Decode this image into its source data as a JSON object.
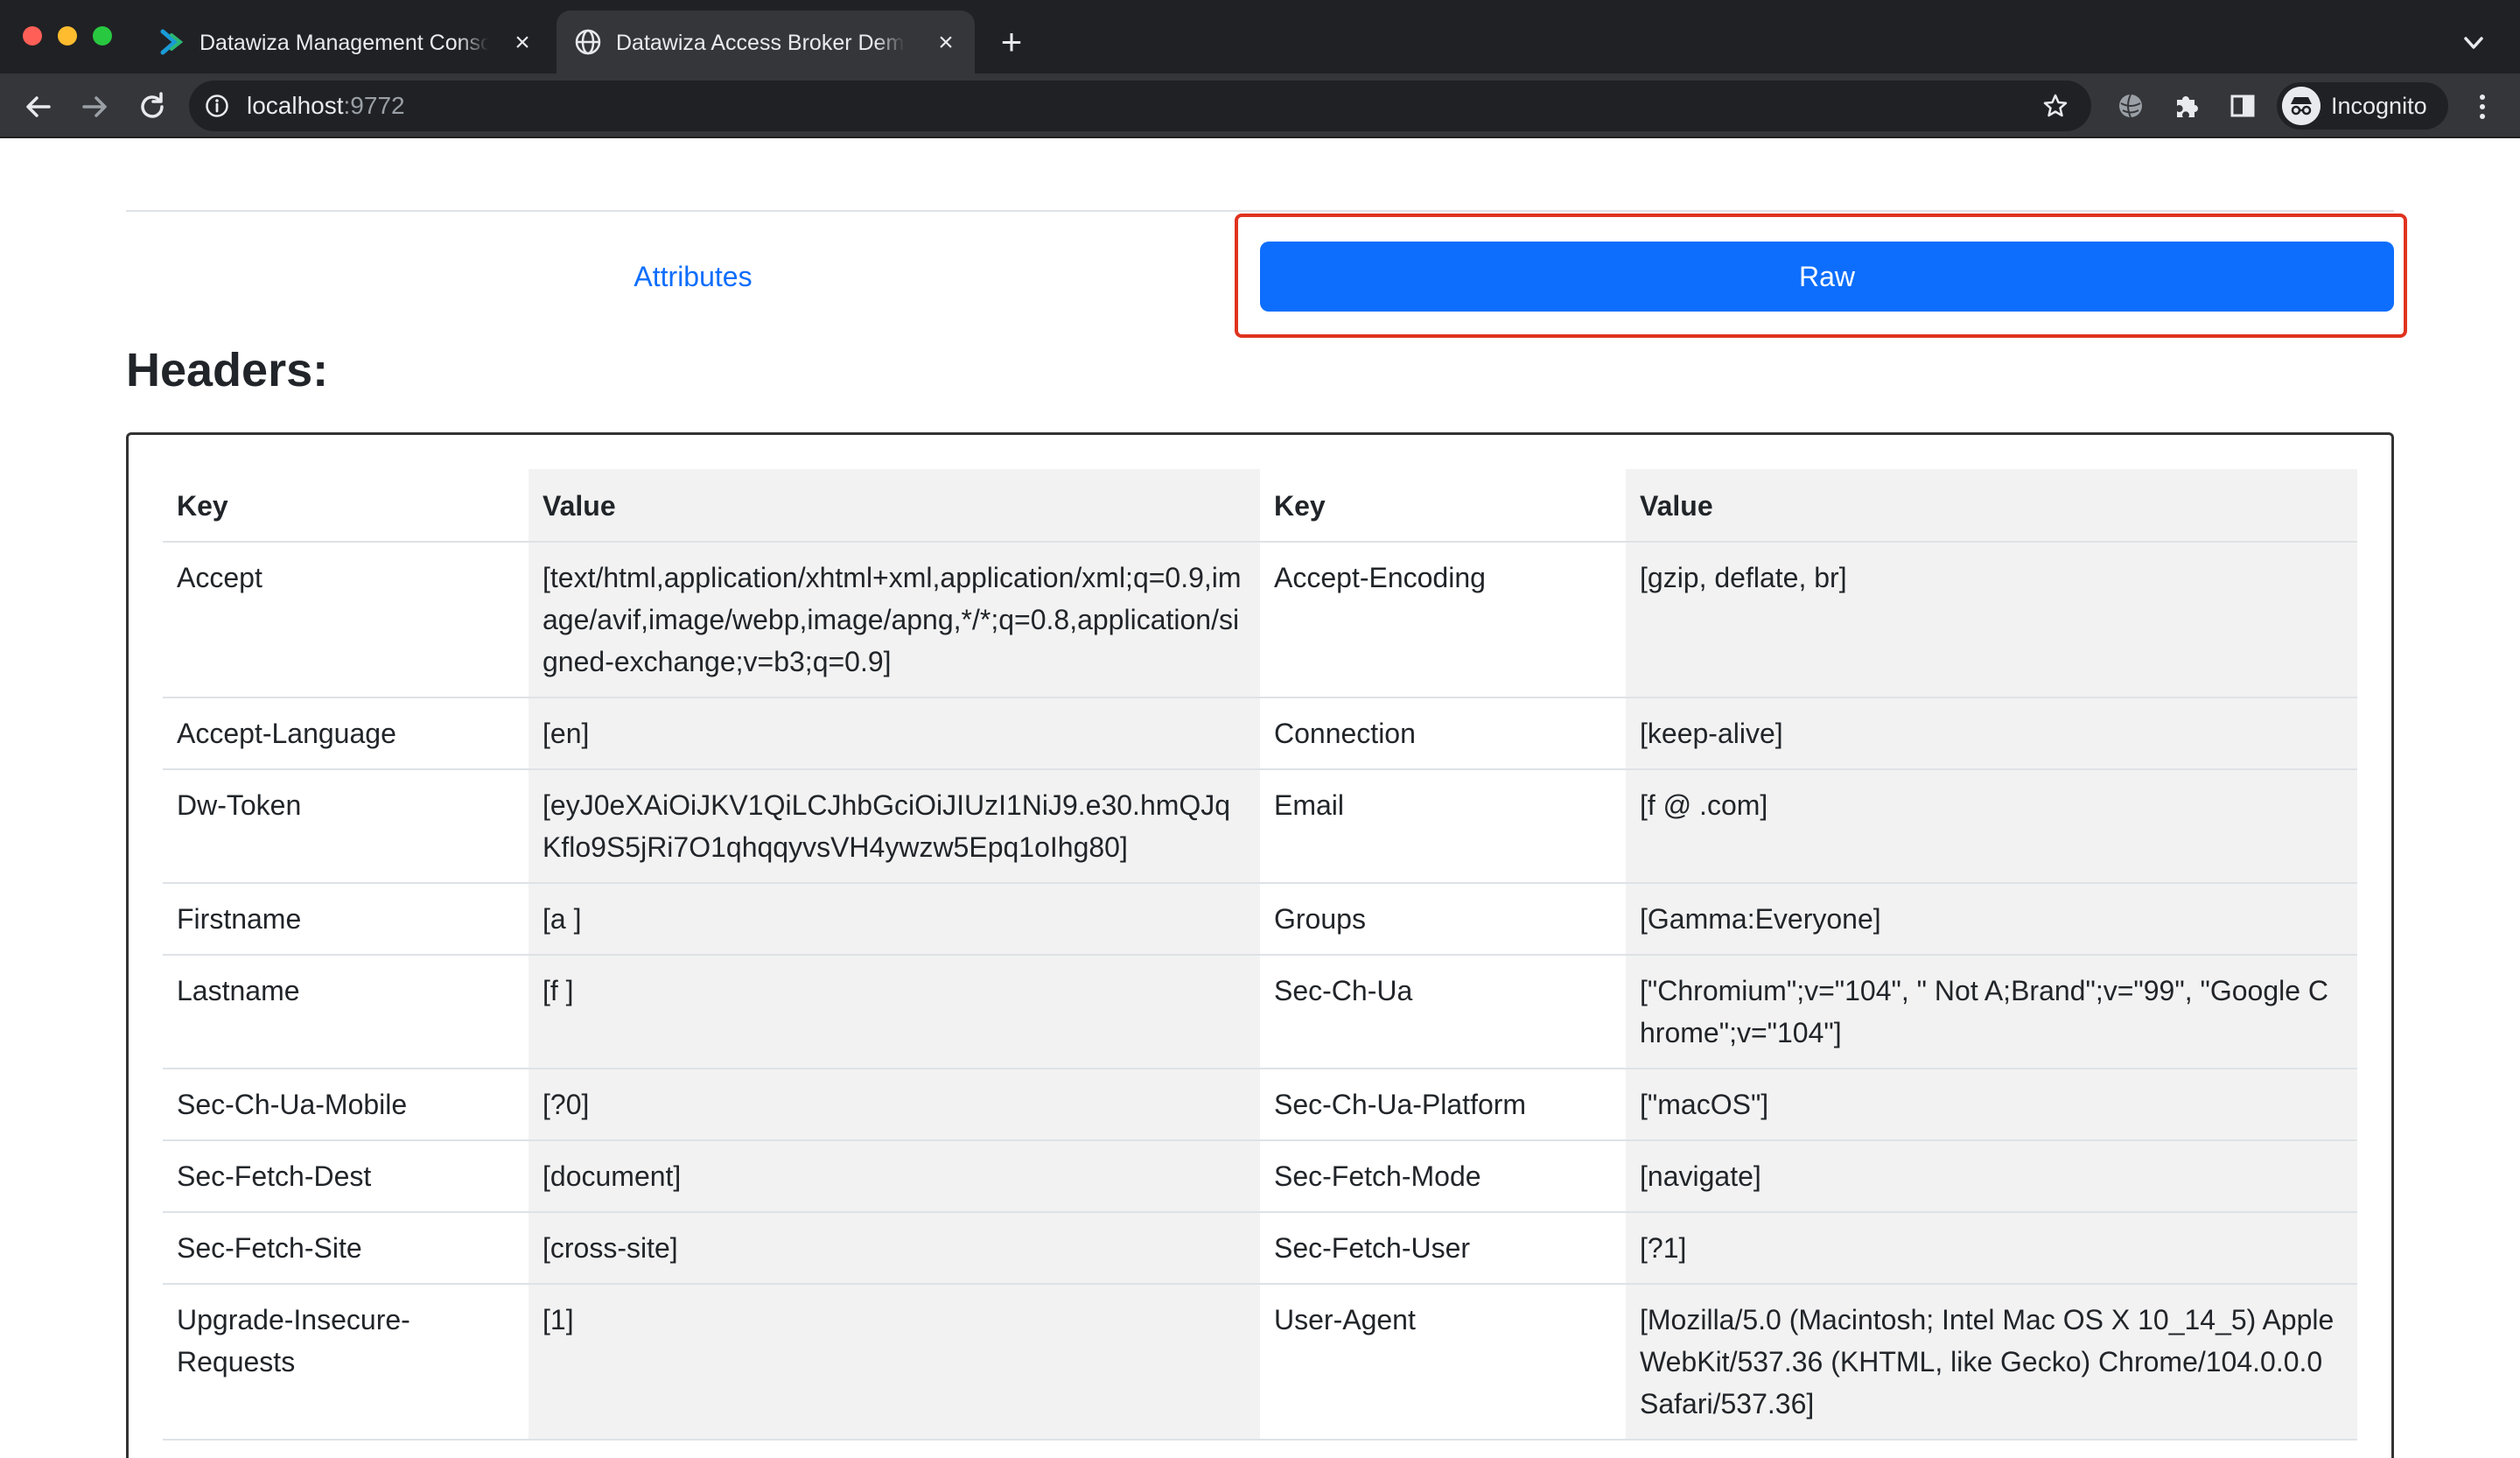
{
  "browser": {
    "tabs": [
      {
        "title": "Datawiza Management Console",
        "active": false,
        "icon": "datawiza-logo-icon"
      },
      {
        "title": "Datawiza Access Broker Demo",
        "active": true,
        "icon": "globe-icon"
      }
    ],
    "new_tab_label": "+",
    "close_label": "×",
    "url_host": "localhost",
    "url_port": ":9772",
    "profile_label": "Incognito"
  },
  "page": {
    "tabs": {
      "attributes_label": "Attributes",
      "raw_label": "Raw"
    },
    "headers_title": "Headers:",
    "table": {
      "columns": [
        "Key",
        "Value",
        "Key",
        "Value"
      ],
      "rows": [
        [
          "Accept",
          "[text/html,application/xhtml+xml,application/xml;q=0.9,image/avif,image/webp,image/apng,*/*;q=0.8,application/signed-exchange;v=b3;q=0.9]",
          "Accept-Encoding",
          "[gzip, deflate, br]"
        ],
        [
          "Accept-Language",
          "[en]",
          "Connection",
          "[keep-alive]"
        ],
        [
          "Dw-Token",
          "[eyJ0eXAiOiJKV1QiLCJhbGciOiJIUzI1NiJ9.e30.hmQJqKflo9S5jRi7O1qhqqyvsVH4ywzw5Epq1oIhg80]",
          "Email",
          "[f          @            .com]"
        ],
        [
          "Firstname",
          "[a          ]",
          "Groups",
          "[Gamma:Everyone]"
        ],
        [
          "Lastname",
          "[f      ]",
          "Sec-Ch-Ua",
          "[\"Chromium\";v=\"104\", \" Not A;Brand\";v=\"99\", \"Google Chrome\";v=\"104\"]"
        ],
        [
          "Sec-Ch-Ua-Mobile",
          "[?0]",
          "Sec-Ch-Ua-Platform",
          "[\"macOS\"]"
        ],
        [
          "Sec-Fetch-Dest",
          "[document]",
          "Sec-Fetch-Mode",
          "[navigate]"
        ],
        [
          "Sec-Fetch-Site",
          "[cross-site]",
          "Sec-Fetch-User",
          "[?1]"
        ],
        [
          "Upgrade-Insecure-Requests",
          "[1]",
          "User-Agent",
          "[Mozilla/5.0 (Macintosh; Intel Mac OS X 10_14_5) AppleWebKit/537.36 (KHTML, like Gecko) Chrome/104.0.0.0 Safari/537.36]"
        ]
      ]
    }
  },
  "colors": {
    "primary": "#0d6efd",
    "highlight": "#e0331e",
    "chrome_dark": "#202124",
    "chrome_toolbar": "#35363a",
    "table_shade": "#f2f2f2"
  }
}
